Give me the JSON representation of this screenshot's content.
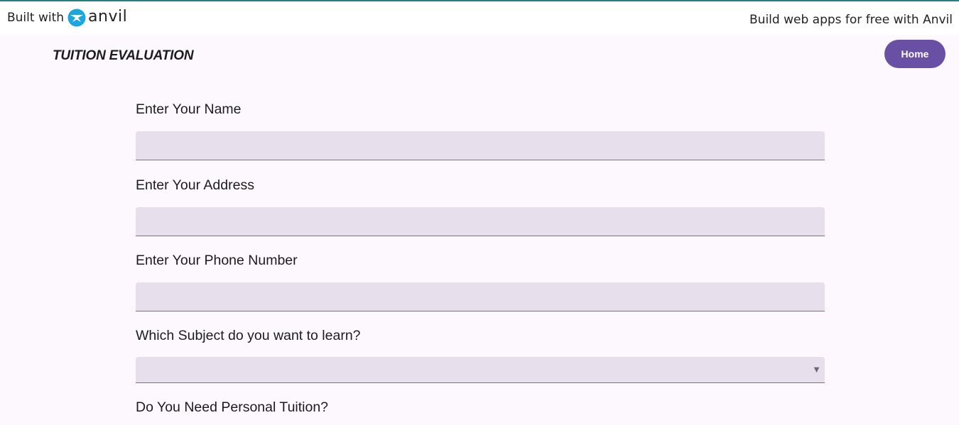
{
  "banner": {
    "built_with": "Built with",
    "brand": "anvil",
    "promo": "Build web apps for free with Anvil"
  },
  "header": {
    "title": "TUITION EVALUATION",
    "home_label": "Home"
  },
  "form": {
    "name_label": "Enter Your Name",
    "name_value": "",
    "address_label": "Enter Your Address",
    "address_value": "",
    "phone_label": "Enter Your Phone Number",
    "phone_value": "",
    "subject_label": "Which Subject do you want to learn?",
    "subject_value": "",
    "personal_label": "Do You Need Personal Tuition?"
  },
  "colors": {
    "accent": "#6a50a4",
    "field_bg": "#e7e0ec",
    "page_bg": "#fdf8fd"
  }
}
